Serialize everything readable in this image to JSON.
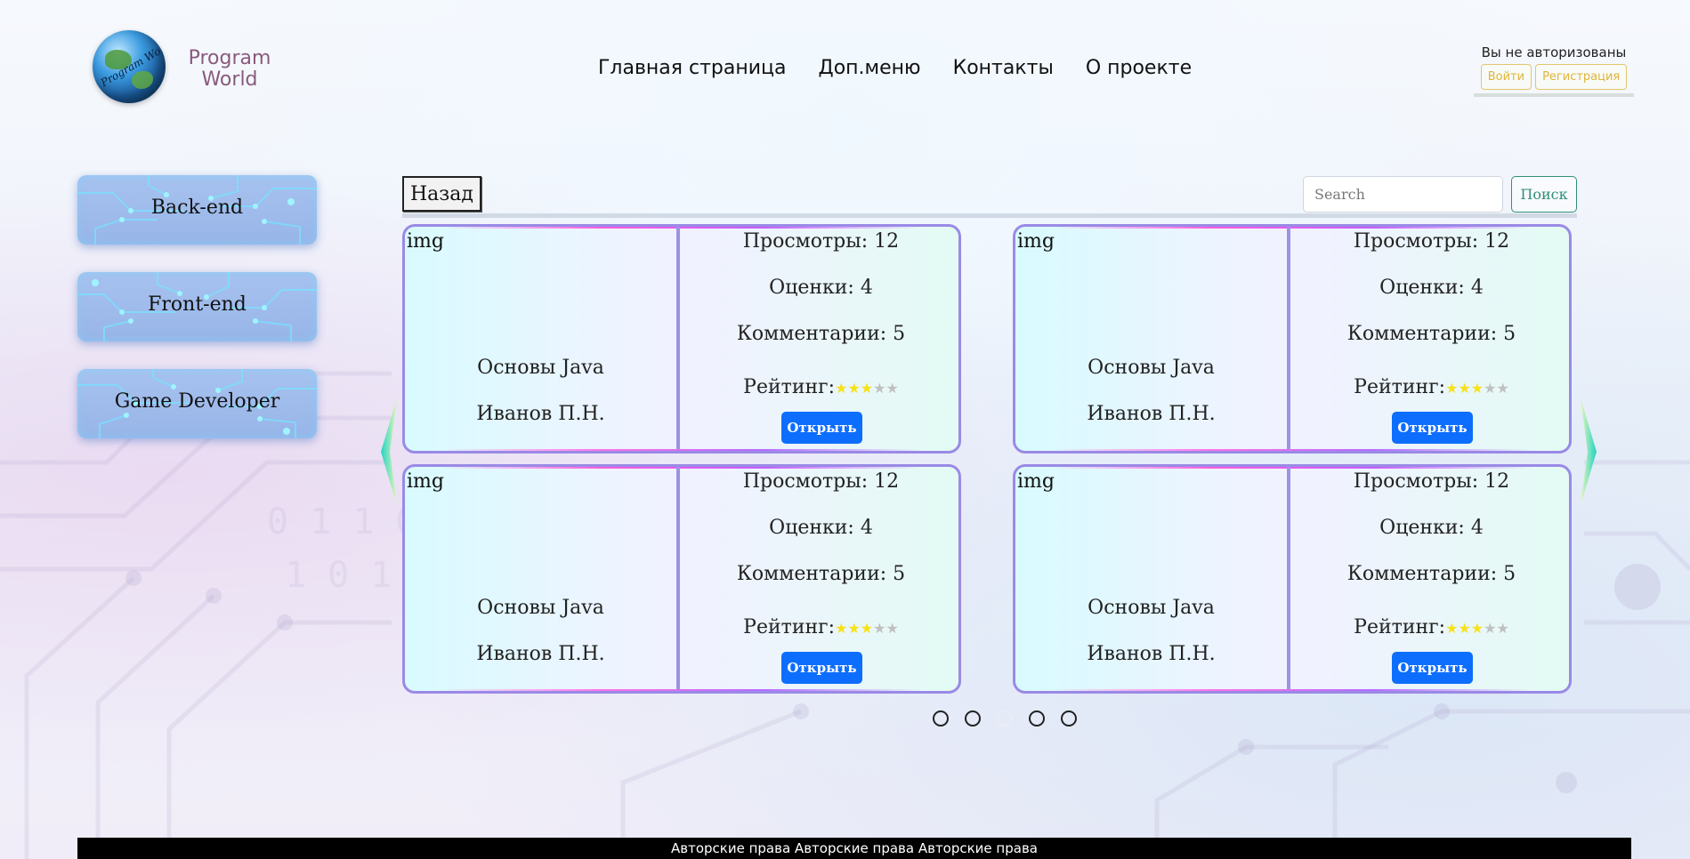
{
  "header": {
    "logo_text": "Program World",
    "brand_line1": "Program",
    "brand_line2": "World",
    "nav": [
      {
        "label": "Главная страница"
      },
      {
        "label": "Доп.меню"
      },
      {
        "label": "Контакты"
      },
      {
        "label": "О проекте"
      }
    ],
    "auth": {
      "status": "Вы не авторизованы",
      "login_label": "Войти",
      "register_label": "Регистрация"
    }
  },
  "sidebar": {
    "items": [
      {
        "label": "Back-end"
      },
      {
        "label": "Front-end"
      },
      {
        "label": "Game Developer"
      }
    ]
  },
  "toolbar": {
    "back_label": "Назад",
    "search_placeholder": "Search",
    "search_button": "Поиск"
  },
  "cards": [
    {
      "img": "img",
      "title": "Основы Java",
      "author": "Иванов П.Н.",
      "views": "Просмотры: 12",
      "grades": "Оценки: 4",
      "comments": "Комментарии: 5",
      "rating_label": "Рейтинг:",
      "rating": 3,
      "rating_max": 5,
      "open_label": "Открыть"
    },
    {
      "img": "img",
      "title": "Основы Java",
      "author": "Иванов П.Н.",
      "views": "Просмотры: 12",
      "grades": "Оценки: 4",
      "comments": "Комментарии: 5",
      "rating_label": "Рейтинг:",
      "rating": 3,
      "rating_max": 5,
      "open_label": "Открыть"
    },
    {
      "img": "img",
      "title": "Основы Java",
      "author": "Иванов П.Н.",
      "views": "Просмотры: 12",
      "grades": "Оценки: 4",
      "comments": "Комментарии: 5",
      "rating_label": "Рейтинг:",
      "rating": 3,
      "rating_max": 5,
      "open_label": "Открыть"
    },
    {
      "img": "img",
      "title": "Основы Java",
      "author": "Иванов П.Н.",
      "views": "Просмотры: 12",
      "grades": "Оценки: 4",
      "comments": "Комментарии: 5",
      "rating_label": "Рейтинг:",
      "rating": 3,
      "rating_max": 5,
      "open_label": "Открыть"
    }
  ],
  "carousel": {
    "page_count": 5,
    "active_page": 3,
    "prev_icon": "chevron-left-icon",
    "next_icon": "chevron-right-icon"
  },
  "footer": {
    "text": "Авторские права Авторские права Авторские права"
  },
  "colors": {
    "accent_blue": "#0d6efd",
    "card_border": "#9a8ae6",
    "auth_yellow": "#e0b43c",
    "search_green": "#2f8f78",
    "star_on": "#f7e11b",
    "star_off": "#c0c0c0"
  }
}
